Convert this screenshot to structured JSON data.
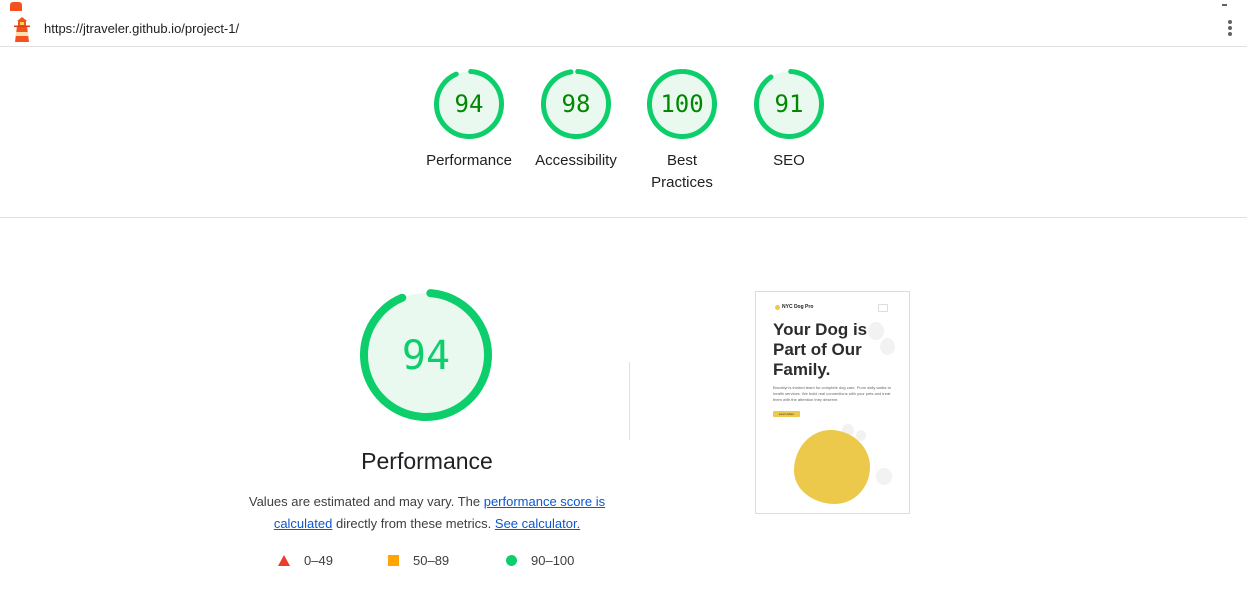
{
  "header": {
    "url": "https://jtraveler.github.io/project-1/"
  },
  "colors": {
    "pass": "#0cce6b",
    "pass_text": "#008800",
    "pass_fill": "#e9f9ef",
    "average": "#ffa400",
    "fail": "#eb3b2b",
    "link": "#0b57d0"
  },
  "gauges": [
    {
      "score": 94,
      "label": "Performance"
    },
    {
      "score": 98,
      "label": "Accessibility"
    },
    {
      "score": 100,
      "label_line1": "Best",
      "label_line2": "Practices"
    },
    {
      "score": 91,
      "label": "SEO"
    }
  ],
  "performance": {
    "score": 94,
    "title": "Performance",
    "desc_prefix": "Values are estimated and may vary. The ",
    "link_score": "performance score is calculated",
    "desc_middle": " directly from these metrics. ",
    "link_calculator": "See calculator."
  },
  "legend": [
    {
      "range": "0–49",
      "icon": "triangle-icon"
    },
    {
      "range": "50–89",
      "icon": "square-icon"
    },
    {
      "range": "90–100",
      "icon": "circle-icon"
    }
  ],
  "screenshot": {
    "brand": "NYC Dog Pro",
    "headline": "Your Dog is Part of Our Family.",
    "copy": "Brooklyn's trusted team for complete dog care. From daily walks to health services. We build real connections with your pets and treat them with the attention they deserve.",
    "button": "Learn More"
  }
}
